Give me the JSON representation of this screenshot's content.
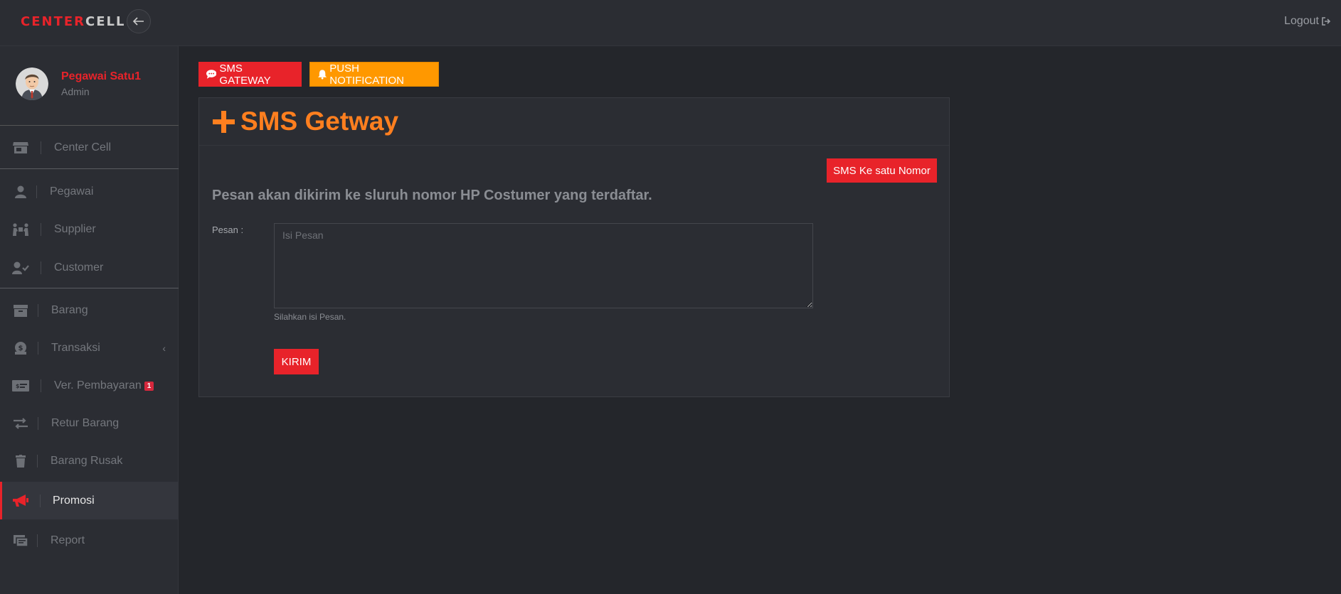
{
  "brand": {
    "part1": "CENTER",
    "part2": "CELL"
  },
  "topbar": {
    "logout_label": "Logout"
  },
  "profile": {
    "name": "Pegawai Satu1",
    "role": "Admin"
  },
  "sidebar": {
    "items": [
      {
        "label": "Center Cell",
        "icon": "store-icon"
      },
      {
        "label": "Pegawai",
        "icon": "user-icon"
      },
      {
        "label": "Supplier",
        "icon": "people-carry-icon"
      },
      {
        "label": "Customer",
        "icon": "user-check-icon"
      },
      {
        "label": "Barang",
        "icon": "archive-icon"
      },
      {
        "label": "Transaksi",
        "icon": "money-bag-icon"
      },
      {
        "label": "Ver. Pembayaran",
        "icon": "money-check-icon",
        "badge": "1"
      },
      {
        "label": "Retur Barang",
        "icon": "exchange-icon"
      },
      {
        "label": "Barang Rusak",
        "icon": "trash-icon"
      },
      {
        "label": "Promosi",
        "icon": "bullhorn-icon",
        "active": true
      },
      {
        "label": "Report",
        "icon": "report-icon"
      }
    ]
  },
  "tabs": {
    "sms": "SMS GATEWAY",
    "push": "PUSH NOTIFICATION"
  },
  "panel": {
    "title": "SMS Getway",
    "single_number_button": "SMS Ke satu Nomor",
    "info": "Pesan akan dikirim ke sluruh nomor HP Costumer yang terdaftar.",
    "message_label": "Pesan :",
    "message_placeholder": "Isi Pesan",
    "message_value": "",
    "help_text": "Silahkan isi Pesan.",
    "submit_label": "KIRIM"
  },
  "colors": {
    "accent": "#e8232a",
    "warning": "#ff9800",
    "title": "#ff7f1f"
  }
}
